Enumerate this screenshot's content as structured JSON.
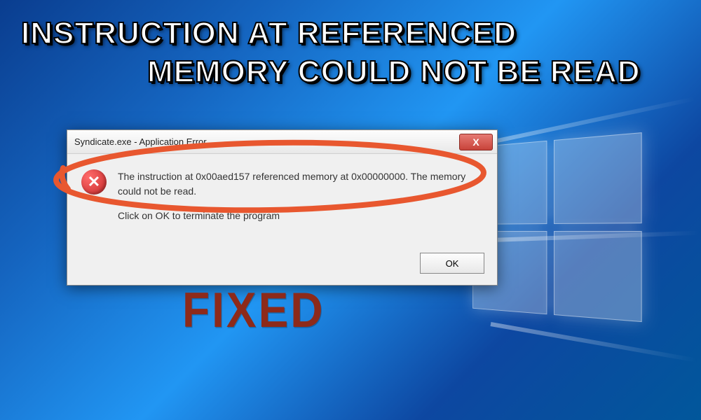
{
  "headline": {
    "line1": "Instruction at Referenced",
    "line2": "Memory Could Not Be Read"
  },
  "dialog": {
    "title": "Syndicate.exe - Application Error",
    "close_label": "X",
    "error_icon_glyph": "✕",
    "message_line1": "The instruction at 0x00aed157 referenced memory at 0x00000000. The memory could not be read.",
    "message_line2": "Click on OK to terminate the program",
    "ok_label": "OK"
  },
  "stamp": "FIXED",
  "colors": {
    "highlight": "#e8572f",
    "stamp": "#8d2a1a"
  }
}
